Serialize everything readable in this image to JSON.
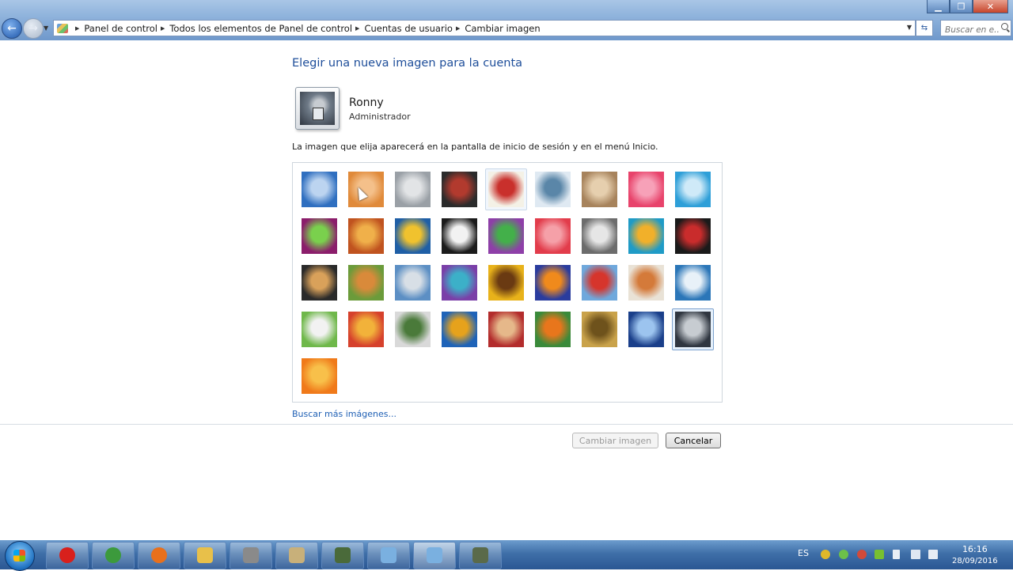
{
  "address_bar": {
    "breadcrumbs": [
      "Panel de control",
      "Todos los elementos de Panel de control",
      "Cuentas de usuario",
      "Cambiar imagen"
    ],
    "search_placeholder": "Buscar en e..."
  },
  "content": {
    "heading": "Elegir una nueva imagen para la cuenta",
    "user_name": "Ronny",
    "user_role": "Administrador",
    "info_text": "La imagen que elija aparecerá en la pantalla de inicio de sesión y en el menú Inicio.",
    "more_images_link": "Buscar más imágenes...",
    "pictures": [
      {
        "name": "roller-coaster",
        "colors": [
          "#2f6fc0",
          "#bcd4f0"
        ]
      },
      {
        "name": "starfish",
        "colors": [
          "#e08a3a",
          "#f4c08a"
        ]
      },
      {
        "name": "robot-figure",
        "colors": [
          "#9aa0a6",
          "#e2e4e6"
        ]
      },
      {
        "name": "record-player",
        "colors": [
          "#2b2b2b",
          "#b23a2e"
        ]
      },
      {
        "name": "lucky-cat",
        "colors": [
          "#f4f1e6",
          "#c9302c"
        ]
      },
      {
        "name": "gyroscope",
        "colors": [
          "#dfe9f2",
          "#5a86a8"
        ]
      },
      {
        "name": "kitten",
        "colors": [
          "#a7835c",
          "#e6cfae"
        ]
      },
      {
        "name": "flower",
        "colors": [
          "#e8436b",
          "#f7a1b8"
        ]
      },
      {
        "name": "pinwheel",
        "colors": [
          "#2e9fd8",
          "#cfeaf8"
        ]
      },
      {
        "name": "ball",
        "colors": [
          "#8b1d6b",
          "#7ad04d"
        ]
      },
      {
        "name": "fabric",
        "colors": [
          "#c0531f",
          "#f0b04a"
        ]
      },
      {
        "name": "leaf",
        "colors": [
          "#1f5fa6",
          "#f0c22e"
        ]
      },
      {
        "name": "dog",
        "colors": [
          "#1b1b1b",
          "#f2f2f2"
        ]
      },
      {
        "name": "crayons",
        "colors": [
          "#8e3fa8",
          "#43b04a"
        ]
      },
      {
        "name": "paper-star",
        "colors": [
          "#e23c4b",
          "#f5a0a8"
        ]
      },
      {
        "name": "jacks",
        "colors": [
          "#6c6c6c",
          "#e6e6e6"
        ]
      },
      {
        "name": "stairs",
        "colors": [
          "#1f9bc6",
          "#f1b02a"
        ]
      },
      {
        "name": "paper-crane",
        "colors": [
          "#1a1a1a",
          "#c92c2c"
        ]
      },
      {
        "name": "guitar",
        "colors": [
          "#2a2a2a",
          "#d9a15a"
        ]
      },
      {
        "name": "puppy",
        "colors": [
          "#6b9b3a",
          "#d98a3a"
        ]
      },
      {
        "name": "toy-robot",
        "colors": [
          "#5c8fc4",
          "#d8dfe6"
        ]
      },
      {
        "name": "scarves",
        "colors": [
          "#7a3fa8",
          "#3cb0c8"
        ]
      },
      {
        "name": "sunflower",
        "colors": [
          "#e8b21a",
          "#6a3a12"
        ]
      },
      {
        "name": "fish",
        "colors": [
          "#2a3c9e",
          "#f08a1c"
        ]
      },
      {
        "name": "balloon",
        "colors": [
          "#6fa8dc",
          "#d6352c"
        ]
      },
      {
        "name": "doll",
        "colors": [
          "#e9e2d6",
          "#d47a3a"
        ]
      },
      {
        "name": "sailboat",
        "colors": [
          "#2b76b8",
          "#e8f1f8"
        ]
      },
      {
        "name": "soccer-ball",
        "colors": [
          "#6fb84a",
          "#f2f2f2"
        ]
      },
      {
        "name": "ribbons",
        "colors": [
          "#d6412c",
          "#f2b23a"
        ]
      },
      {
        "name": "marbles",
        "colors": [
          "#d9d9d9",
          "#4a7a3a"
        ]
      },
      {
        "name": "window",
        "colors": [
          "#1e63b8",
          "#e6a21c"
        ]
      },
      {
        "name": "rug",
        "colors": [
          "#b32c2c",
          "#e6b88a"
        ]
      },
      {
        "name": "butterfly",
        "colors": [
          "#3a8a3a",
          "#e8761c"
        ]
      },
      {
        "name": "spiral",
        "colors": [
          "#c9a24a",
          "#6e521c"
        ]
      },
      {
        "name": "lighthouse",
        "colors": [
          "#1a3f8a",
          "#9cc4ef"
        ]
      },
      {
        "name": "user-photo",
        "colors": [
          "#2f3640",
          "#c7ccd1"
        ]
      },
      {
        "name": "orange-daisy",
        "colors": [
          "#f07a1a",
          "#f8c04a"
        ]
      }
    ]
  },
  "buttons": {
    "change_image": "Cambiar imagen",
    "cancel": "Cancelar"
  },
  "taskbar": {
    "apps": [
      "opera",
      "chrome",
      "firefox",
      "file-explorer",
      "media-player",
      "paint",
      "sketchup",
      "window-manager",
      "control-panel",
      "app-utility"
    ],
    "language": "ES",
    "time": "16:16",
    "date": "28/09/2016"
  }
}
